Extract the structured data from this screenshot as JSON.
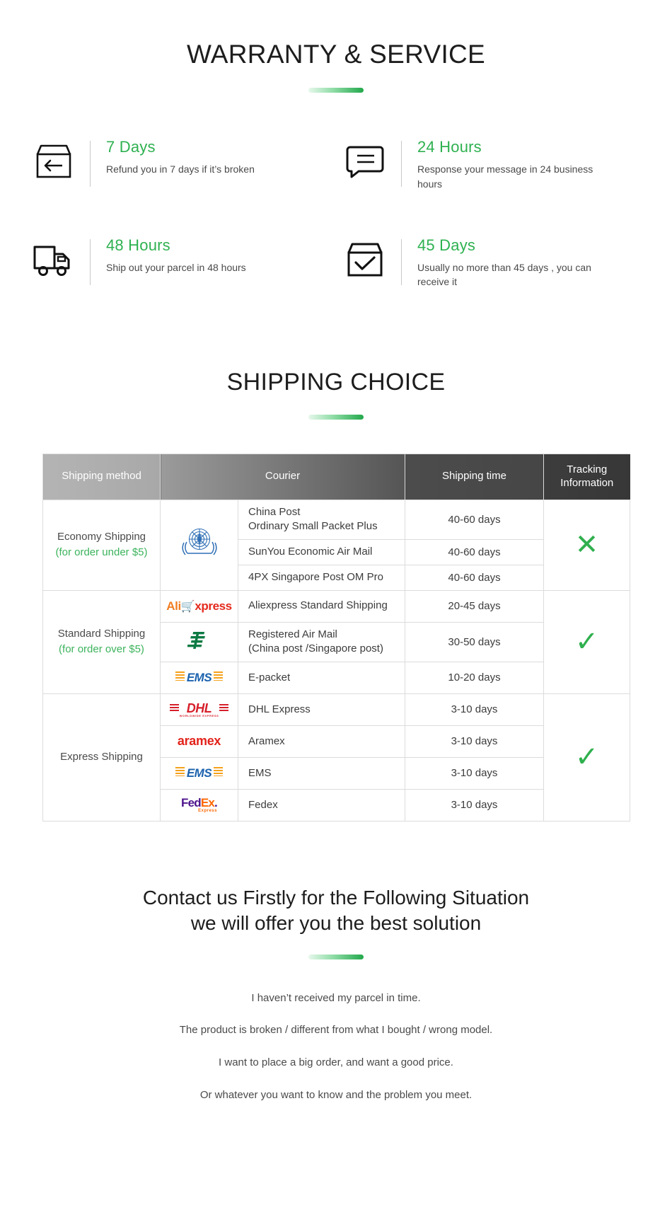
{
  "warranty": {
    "title": "WARRANTY & SERVICE",
    "features": [
      {
        "icon": "box-return-icon",
        "title": "7 Days",
        "desc": "Refund you in 7 days if it’s broken"
      },
      {
        "icon": "speech-bubble-icon",
        "title": "24 Hours",
        "desc": "Response your message in 24 business hours"
      },
      {
        "icon": "truck-icon",
        "title": "48 Hours",
        "desc": "Ship out your parcel in 48 hours"
      },
      {
        "icon": "box-check-icon",
        "title": "45 Days",
        "desc": "Usually no more than 45 days , you can receive it"
      }
    ]
  },
  "shipping": {
    "title": "SHIPPING CHOICE",
    "columns": [
      "Shipping method",
      "Courier",
      "Shipping time",
      "Tracking Information"
    ],
    "groups": [
      {
        "method": "Economy Shipping",
        "method_sub": "(for order under $5)",
        "logo": "un-logo",
        "logo_label": "",
        "tracking": "✕",
        "tracking_type": "cross",
        "rows": [
          {
            "logo": "un-logo",
            "carrier": "China Post\nOrdinary Small Packet Plus",
            "time": "40-60 days"
          },
          {
            "logo": "",
            "carrier": "SunYou Economic Air Mail",
            "time": "40-60 days"
          },
          {
            "logo": "",
            "carrier": "4PX Singapore Post OM Pro",
            "time": "40-60 days"
          }
        ]
      },
      {
        "method": "Standard Shipping",
        "method_sub": "(for order over $5)",
        "tracking": "✓",
        "tracking_type": "check",
        "rows": [
          {
            "logo": "aliexpress-logo",
            "carrier": "Aliexpress Standard Shipping",
            "time": "20-45 days"
          },
          {
            "logo": "china-post-logo",
            "carrier": "Registered Air Mail\n(China post /Singapore post)",
            "time": "30-50 days"
          },
          {
            "logo": "ems-logo",
            "carrier": "E-packet",
            "time": "10-20 days"
          }
        ]
      },
      {
        "method": "Express Shipping",
        "method_sub": "",
        "tracking": "✓",
        "tracking_type": "check",
        "rows": [
          {
            "logo": "dhl-logo",
            "carrier": "DHL Express",
            "time": "3-10 days"
          },
          {
            "logo": "aramex-logo",
            "carrier": "Aramex",
            "time": "3-10 days"
          },
          {
            "logo": "ems-logo",
            "carrier": "EMS",
            "time": "3-10 days"
          },
          {
            "logo": "fedex-logo",
            "carrier": "Fedex",
            "time": "3-10 days"
          }
        ]
      }
    ]
  },
  "contact": {
    "line1": "Contact us Firstly for the Following Situation",
    "line2": "we will offer you the best solution",
    "items": [
      "I haven’t received my parcel in time.",
      "The product is broken / different from what I bought / wrong model.",
      "I want to place a big order, and want a good price.",
      "Or whatever you want to know and the problem you meet."
    ]
  },
  "colors": {
    "accent_green": "#2eb150",
    "mark_green": "#31b04f",
    "text": "#3c3c3c"
  }
}
